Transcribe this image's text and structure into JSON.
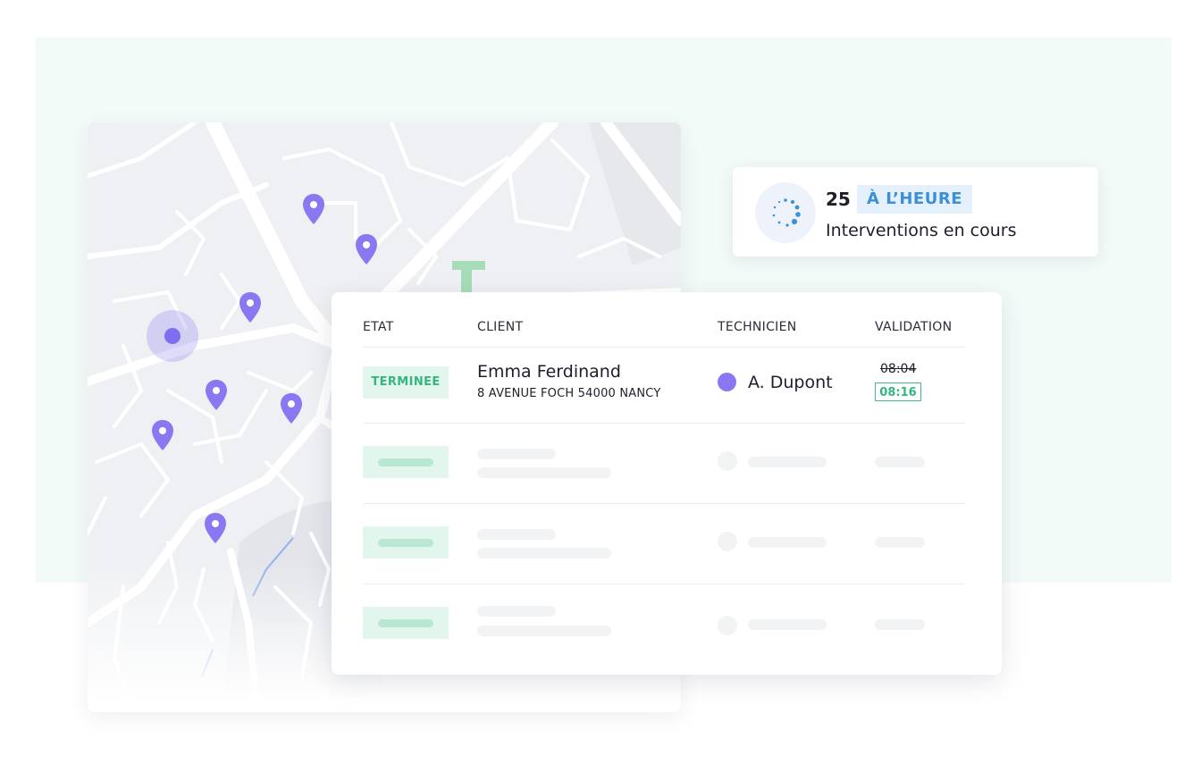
{
  "status": {
    "count": "25",
    "badge": "À L’HEURE",
    "description": "Interventions en cours",
    "spinner_icon": "loading-spinner-icon",
    "badge_color": "#3d8fd6"
  },
  "table": {
    "headers": {
      "state": "ETAT",
      "client": "CLIENT",
      "technician": "TECHNICIEN",
      "validation": "VALIDATION"
    },
    "rows": [
      {
        "state": "TERMINEE",
        "client_name": "Emma Ferdinand",
        "client_address": "8 AVENUE FOCH 54000 NANCY",
        "technician": "A. Dupont",
        "planned_time": "08:04",
        "actual_time": "08:16"
      }
    ]
  },
  "map": {
    "pin_icon": "map-pin-icon",
    "pin_color": "#8a78f3",
    "current_location_icon": "current-location-icon"
  },
  "colors": {
    "accent": "#8a78f3",
    "success": "#33b77f",
    "success_bg": "#e3f6ee",
    "info_bg": "#e4f0fb"
  }
}
